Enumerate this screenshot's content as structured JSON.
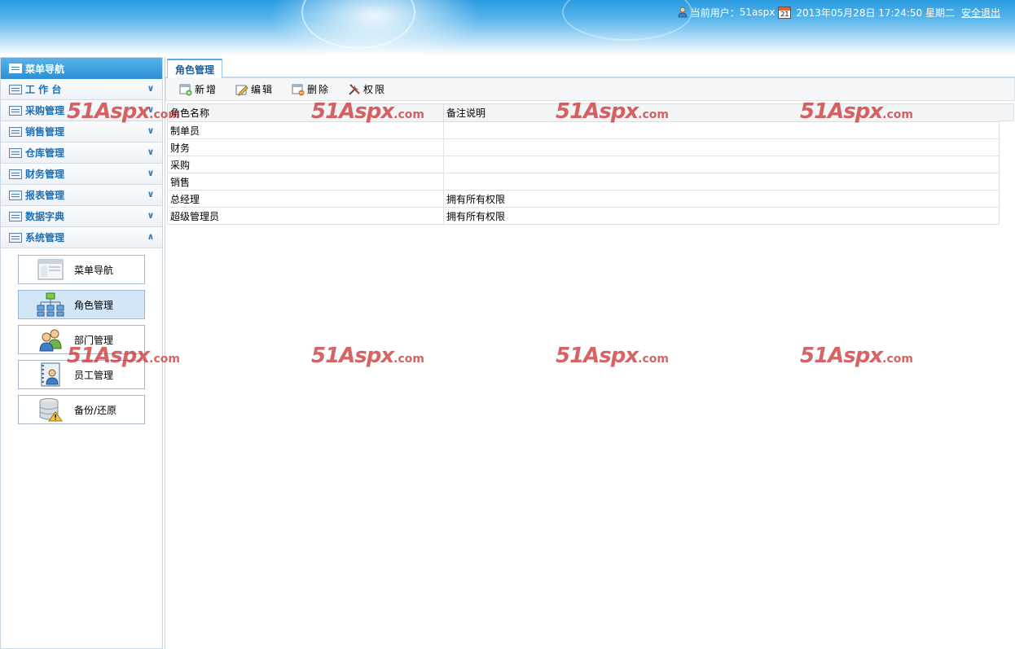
{
  "header": {
    "user_label": "当前用户：",
    "username": "51aspx",
    "calendar_day": "21",
    "datetime": "2013年05月28日 17:24:50 星期二",
    "logout": "安全退出"
  },
  "sidebar": {
    "title": "菜单导航",
    "groups": [
      {
        "label": "工 作 台",
        "expanded": false
      },
      {
        "label": "采购管理",
        "expanded": false
      },
      {
        "label": "销售管理",
        "expanded": false
      },
      {
        "label": "仓库管理",
        "expanded": false
      },
      {
        "label": "财务管理",
        "expanded": false
      },
      {
        "label": "报表管理",
        "expanded": false
      },
      {
        "label": "数据字典",
        "expanded": false
      },
      {
        "label": "系统管理",
        "expanded": true
      }
    ],
    "sub_items": [
      {
        "label": "菜单导航",
        "icon": "window-icon",
        "active": false
      },
      {
        "label": "角色管理",
        "icon": "org-chart-icon",
        "active": true
      },
      {
        "label": "部门管理",
        "icon": "users-icon",
        "active": false
      },
      {
        "label": "员工管理",
        "icon": "contact-book-icon",
        "active": false
      },
      {
        "label": "备份/还原",
        "icon": "database-warning-icon",
        "active": false
      }
    ]
  },
  "main": {
    "tab_label": "角色管理",
    "toolbar": {
      "add": "新增",
      "edit": "编辑",
      "delete": "删除",
      "permission": "权限"
    },
    "table": {
      "columns": [
        "角色名称",
        "备注说明"
      ],
      "rows": [
        [
          "制单员",
          ""
        ],
        [
          "财务",
          ""
        ],
        [
          "采购",
          ""
        ],
        [
          "销售",
          ""
        ],
        [
          "总经理",
          "拥有所有权限"
        ],
        [
          "超级管理员",
          "拥有所有权限"
        ]
      ]
    }
  },
  "watermark": {
    "text": "51Aspx",
    "suffix": ".com"
  },
  "colors": {
    "accent": "#2c8fd4",
    "group_text": "#1e6fb4",
    "watermark": "#c82828",
    "active_item": "#d2e6f8"
  }
}
